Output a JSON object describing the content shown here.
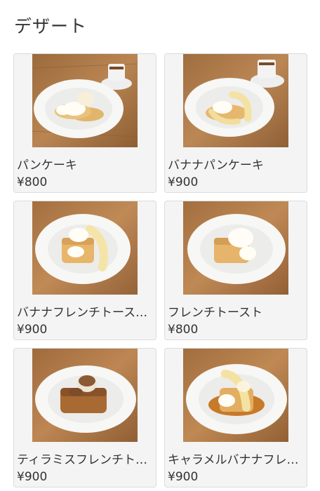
{
  "page": {
    "title": "デザート"
  },
  "items": [
    {
      "name": "パンケーキ",
      "price": "¥800",
      "image": "pancake-photo"
    },
    {
      "name": "バナナパンケーキ",
      "price": "¥900",
      "image": "banana-pancake-photo"
    },
    {
      "name": "バナナフレンチトース…",
      "price": "¥900",
      "image": "banana-french-toast-photo"
    },
    {
      "name": "フレンチトースト",
      "price": "¥800",
      "image": "french-toast-photo"
    },
    {
      "name": "ティラミスフレンチト…",
      "price": "¥900",
      "image": "tiramisu-french-toast-photo"
    },
    {
      "name": "キャラメルバナナフレ…",
      "price": "¥900",
      "image": "caramel-banana-french-toast-photo"
    }
  ],
  "colors": {
    "card_bg": "#f4f4f4",
    "card_border": "#dcdcdc",
    "table_wood": "#b07a48",
    "plate": "#f7f7f5"
  }
}
